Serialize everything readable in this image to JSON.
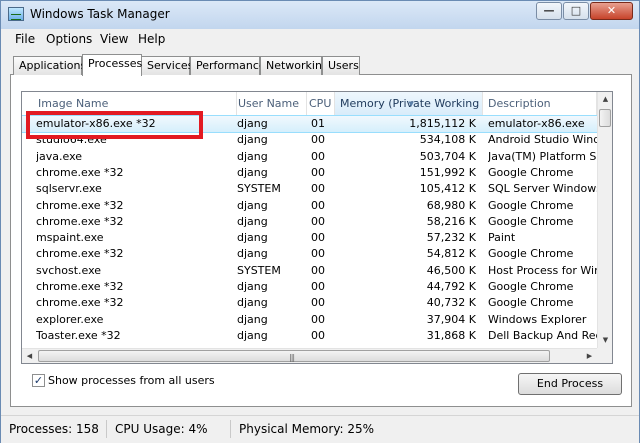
{
  "window": {
    "title": "Windows Task Manager"
  },
  "menu": [
    "File",
    "Options",
    "View",
    "Help"
  ],
  "tabs": [
    "Applications",
    "Processes",
    "Services",
    "Performance",
    "Networking",
    "Users"
  ],
  "active_tab": "Processes",
  "columns": [
    "Image Name",
    "User Name",
    "CPU",
    "Memory (Private Working S...",
    "Description"
  ],
  "rows": [
    {
      "image": "emulator-x86.exe *32",
      "user": "djang",
      "cpu": "01",
      "memory": "1,815,112 K",
      "description": "emulator-x86.exe"
    },
    {
      "image": "studio64.exe",
      "user": "djang",
      "cpu": "00",
      "memory": "534,108 K",
      "description": "Android Studio Window"
    },
    {
      "image": "java.exe",
      "user": "djang",
      "cpu": "00",
      "memory": "503,704 K",
      "description": "Java(TM) Platform SE b"
    },
    {
      "image": "chrome.exe *32",
      "user": "djang",
      "cpu": "00",
      "memory": "151,992 K",
      "description": "Google Chrome"
    },
    {
      "image": "sqlservr.exe",
      "user": "SYSTEM",
      "cpu": "00",
      "memory": "105,412 K",
      "description": "SQL Server Windows N"
    },
    {
      "image": "chrome.exe *32",
      "user": "djang",
      "cpu": "00",
      "memory": "68,980 K",
      "description": "Google Chrome"
    },
    {
      "image": "chrome.exe *32",
      "user": "djang",
      "cpu": "00",
      "memory": "58,216 K",
      "description": "Google Chrome"
    },
    {
      "image": "mspaint.exe",
      "user": "djang",
      "cpu": "00",
      "memory": "57,232 K",
      "description": "Paint"
    },
    {
      "image": "chrome.exe *32",
      "user": "djang",
      "cpu": "00",
      "memory": "54,812 K",
      "description": "Google Chrome"
    },
    {
      "image": "svchost.exe",
      "user": "SYSTEM",
      "cpu": "00",
      "memory": "46,500 K",
      "description": "Host Process for Windo"
    },
    {
      "image": "chrome.exe *32",
      "user": "djang",
      "cpu": "00",
      "memory": "44,792 K",
      "description": "Google Chrome"
    },
    {
      "image": "chrome.exe *32",
      "user": "djang",
      "cpu": "00",
      "memory": "40,732 K",
      "description": "Google Chrome"
    },
    {
      "image": "explorer.exe",
      "user": "djang",
      "cpu": "00",
      "memory": "37,904 K",
      "description": "Windows Explorer"
    },
    {
      "image": "Toaster.exe *32",
      "user": "djang",
      "cpu": "00",
      "memory": "31,868 K",
      "description": "Dell Backup And Recov"
    }
  ],
  "show_all_users": {
    "label": "Show processes from all users",
    "checked": true
  },
  "end_process_label": "End Process",
  "status": {
    "processes": "Processes: 158",
    "cpu": "CPU Usage: 4%",
    "memory": "Physical Memory: 25%"
  },
  "colors": {
    "highlight": "#e21a22",
    "selected_row": "#d5effc"
  }
}
